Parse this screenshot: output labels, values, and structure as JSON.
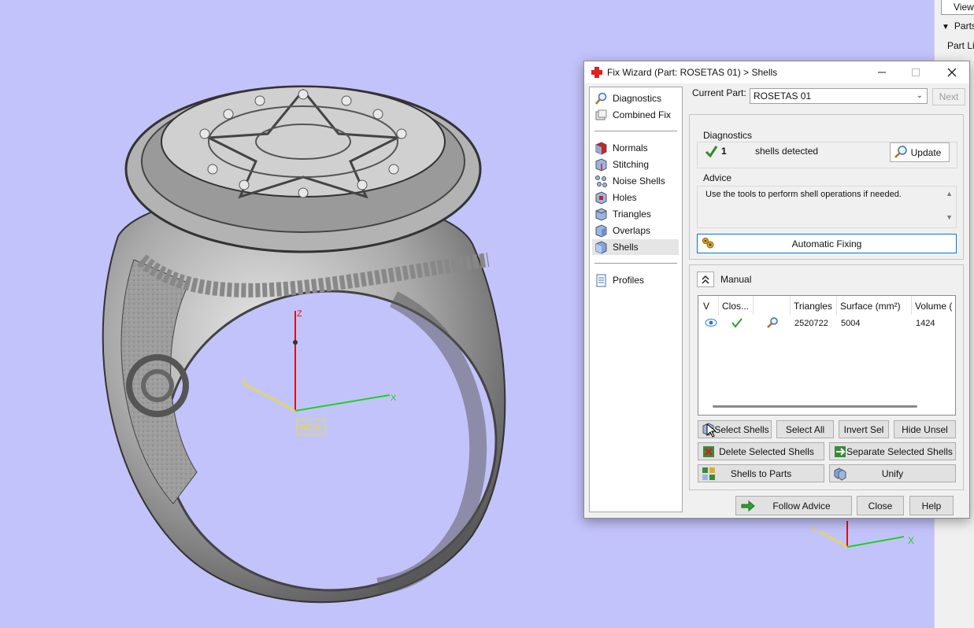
{
  "viewport": {
    "wcs_label": "WCS",
    "axis_x": "X",
    "axis_y": "Y",
    "axis_z": "Z",
    "mini_axis_x": "X",
    "mini_axis_y": "Y"
  },
  "right_panel": {
    "view_tab": "View",
    "parts_header": "Parts",
    "part_list": "Part List"
  },
  "dialog": {
    "title": "Fix Wizard (Part: ROSETAS 01) > Shells",
    "nav": {
      "items": [
        {
          "label": "Diagnostics",
          "icon": "magnifier-icon"
        },
        {
          "label": "Combined Fix",
          "icon": "combined-fix-icon"
        },
        {
          "label": "Normals",
          "icon": "normals-icon"
        },
        {
          "label": "Stitching",
          "icon": "stitching-icon"
        },
        {
          "label": "Noise Shells",
          "icon": "noise-shells-icon"
        },
        {
          "label": "Holes",
          "icon": "holes-icon"
        },
        {
          "label": "Triangles",
          "icon": "triangles-icon"
        },
        {
          "label": "Overlaps",
          "icon": "overlaps-icon"
        },
        {
          "label": "Shells",
          "icon": "shells-icon"
        },
        {
          "label": "Profiles",
          "icon": "profiles-icon"
        }
      ],
      "selected": "Shells"
    },
    "current_part_label": "Current Part:",
    "current_part_value": "ROSETAS 01",
    "next_label": "Next",
    "diagnostics": {
      "label": "Diagnostics",
      "count": "1",
      "status_text": "shells detected",
      "update_label": "Update"
    },
    "advice": {
      "label": "Advice",
      "text": "Use the tools to perform shell operations if needed."
    },
    "automatic_fixing_label": "Automatic Fixing",
    "manual": {
      "label": "Manual",
      "columns": [
        "V",
        "Clos...",
        "",
        "Triangles",
        "Surface (mm²)",
        "Volume ("
      ],
      "rows": [
        {
          "triangles": "2520722",
          "surface": "5004",
          "volume": "1424"
        }
      ]
    },
    "buttons": {
      "select_shells": "Select Shells",
      "select_all": "Select All",
      "invert_sel": "Invert Sel",
      "hide_unsel": "Hide Unsel",
      "delete_selected_shells": "Delete Selected Shells",
      "separate_selected_shells": "Separate Selected Shells",
      "shells_to_parts": "Shells to Parts",
      "unify": "Unify",
      "follow_advice": "Follow Advice",
      "close": "Close",
      "help": "Help"
    }
  },
  "colors": {
    "viewport_bg": "#c3c3fb",
    "accent_blue": "#0078d7",
    "check_green": "#2e8b2e",
    "axis_red": "#e01010",
    "axis_green": "#1fd11f",
    "axis_yellow": "#e8e020"
  }
}
